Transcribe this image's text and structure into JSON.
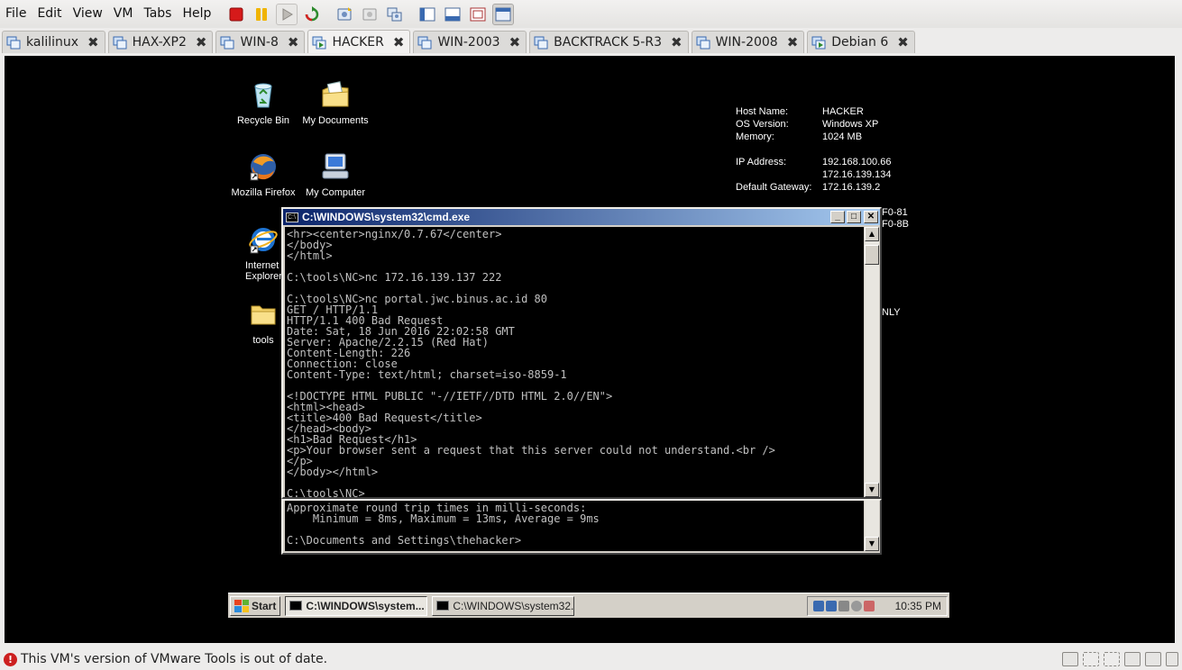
{
  "menubar": {
    "items": [
      "File",
      "Edit",
      "View",
      "VM",
      "Tabs",
      "Help"
    ],
    "toolbar": [
      "power-off-icon",
      "pause-icon",
      "play-icon",
      "reset-icon",
      "snapshot-icon",
      "revert-snapshot-icon",
      "snapshot-manager-icon",
      "quick-switch-icon",
      "console-view-icon",
      "fullscreen-icon",
      "unity-icon"
    ]
  },
  "tabs": [
    {
      "label": "kalilinux",
      "active": false
    },
    {
      "label": "HAX-XP2",
      "active": false
    },
    {
      "label": "WIN-8",
      "active": false
    },
    {
      "label": "HACKER",
      "active": true
    },
    {
      "label": "WIN-2003",
      "active": false
    },
    {
      "label": "BACKTRACK 5-R3",
      "active": false
    },
    {
      "label": "WIN-2008",
      "active": false
    },
    {
      "label": "Debian 6",
      "active": false
    }
  ],
  "desktop": {
    "icons": [
      {
        "label": "Recycle Bin",
        "icon": "recycle-bin-icon"
      },
      {
        "label": "My Documents",
        "icon": "my-documents-icon"
      },
      {
        "label": "Mozilla Firefox",
        "icon": "firefox-icon"
      },
      {
        "label": "My Computer",
        "icon": "my-computer-icon"
      },
      {
        "label": "Internet Explorer",
        "icon": "internet-explorer-icon"
      },
      {
        "label": "tools",
        "icon": "folder-icon"
      }
    ],
    "bginfo": {
      "host_name_label": "Host Name:",
      "host_name": "HACKER",
      "os_label": "OS Version:",
      "os": "Windows XP",
      "memory_label": "Memory:",
      "memory": "1024 MB",
      "ip_label": "IP Address:",
      "ip1": "192.168.100.66",
      "ip2": "172.16.139.134",
      "gateway_label": "Default Gateway:",
      "gateway": "172.16.139.2"
    },
    "clipped_text": [
      "F0-81",
      "F0-8B",
      "NLY"
    ]
  },
  "cmd_front": {
    "title": "C:\\WINDOWS\\system32\\cmd.exe",
    "lines": "<hr><center>nginx/0.7.67</center>\n</body>\n</html>\n\nC:\\tools\\NC>nc 172.16.139.137 222\n\nC:\\tools\\NC>nc portal.jwc.binus.ac.id 80\nGET / HTTP/1.1\nHTTP/1.1 400 Bad Request\nDate: Sat, 18 Jun 2016 22:02:58 GMT\nServer: Apache/2.2.15 (Red Hat)\nContent-Length: 226\nConnection: close\nContent-Type: text/html; charset=iso-8859-1\n\n<!DOCTYPE HTML PUBLIC \"-//IETF//DTD HTML 2.0//EN\">\n<html><head>\n<title>400 Bad Request</title>\n</head><body>\n<h1>Bad Request</h1>\n<p>Your browser sent a request that this server could not understand.<br />\n</p>\n</body></html>\n\nC:\\tools\\NC>"
  },
  "cmd_back": {
    "lines": "Approximate round trip times in milli-seconds:\n    Minimum = 8ms, Maximum = 13ms, Average = 9ms\n\nC:\\Documents and Settings\\thehacker>"
  },
  "guest_taskbar": {
    "start_label": "Start",
    "task1": "C:\\WINDOWS\\system...",
    "task2": "C:\\WINDOWS\\system32...",
    "clock": "10:35 PM"
  },
  "statusbar": {
    "message": "This VM's version of VMware Tools is out of date."
  }
}
